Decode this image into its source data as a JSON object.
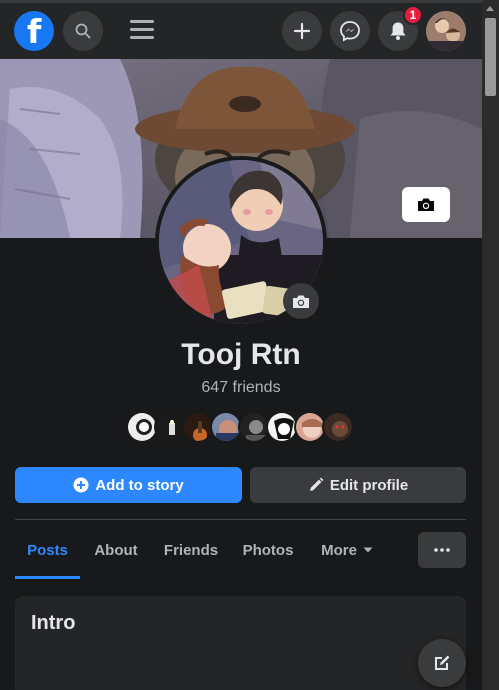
{
  "topbar": {
    "logo_letter": "f",
    "notifications_count": "1"
  },
  "icons": {
    "logo": "facebook-logo-icon",
    "search": "search-icon",
    "menu": "hamburger-menu-icon",
    "create": "plus-icon",
    "messenger": "messenger-icon",
    "notifications": "bell-icon",
    "camera": "camera-icon",
    "add": "plus-circle-icon",
    "edit": "pencil-icon",
    "more": "ellipsis-icon",
    "compose": "compose-icon"
  },
  "profile": {
    "name": "Tooj Rtn",
    "friends_text": "647 friends"
  },
  "actions": {
    "add_story": "Add to story",
    "edit_profile": "Edit profile"
  },
  "tabs": [
    {
      "label": "Posts",
      "active": true
    },
    {
      "label": "About",
      "active": false
    },
    {
      "label": "Friends",
      "active": false
    },
    {
      "label": "Photos",
      "active": false
    },
    {
      "label": "More",
      "active": false
    }
  ],
  "intro": {
    "title": "Intro"
  },
  "colors": {
    "accent": "#2d88ff",
    "background": "#18191a",
    "surface": "#242526",
    "badge": "#e41e3f"
  }
}
